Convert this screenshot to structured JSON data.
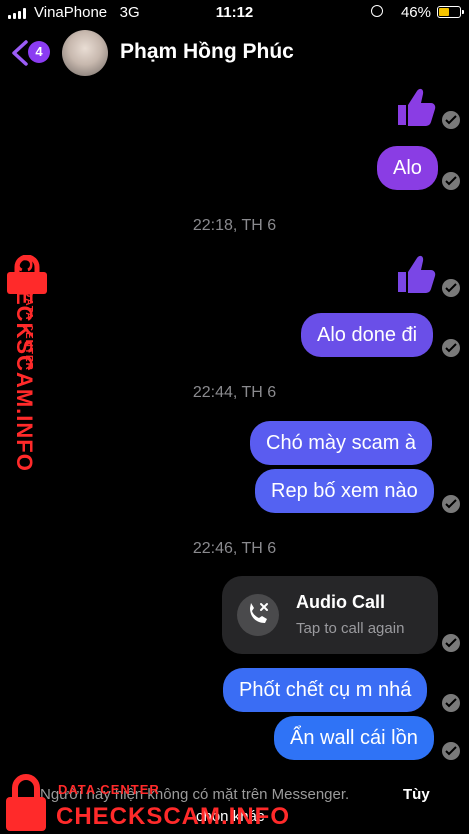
{
  "status_bar": {
    "carrier": "VinaPhone",
    "network": "3G",
    "time": "11:12",
    "battery_percent": "46%",
    "battery_level": 0.46
  },
  "header": {
    "back_badge_count": "4",
    "contact_name": "Phạm Hồng Phúc"
  },
  "messages": [
    {
      "type": "sticker",
      "icon": "thumbs-up"
    },
    {
      "type": "text",
      "text": "Alo"
    },
    {
      "type": "timestamp",
      "text": "22:18, TH 6"
    },
    {
      "type": "sticker",
      "icon": "thumbs-up"
    },
    {
      "type": "text",
      "text": "Alo done đi"
    },
    {
      "type": "timestamp",
      "text": "22:44, TH 6"
    },
    {
      "type": "text",
      "text": "Chó mày scam à"
    },
    {
      "type": "text",
      "text": "Rep bố xem nào"
    },
    {
      "type": "timestamp",
      "text": "22:46, TH 6"
    },
    {
      "type": "call",
      "title": "Audio Call",
      "subtitle": "Tap to call again",
      "icon": "missed-call"
    },
    {
      "type": "text",
      "text": "Phốt chết cụ m nhá"
    },
    {
      "type": "text",
      "text": "Ẩn wall cái lồn"
    }
  ],
  "footer": {
    "notice": "Người này hiện không có mặt trên Messenger.",
    "option_label": "Tùy",
    "option_label_2": "chọn khác"
  },
  "watermark": {
    "small": "DATA CENTER",
    "big": "CHECKSCAM.INFO"
  },
  "colors": {
    "bubble_purple": "#8a3de4",
    "bubble_mid": "#6a4fe8",
    "bubble_blue": "#2f73f6",
    "badge": "#8b3cf2",
    "watermark": "#ff2a2a"
  }
}
